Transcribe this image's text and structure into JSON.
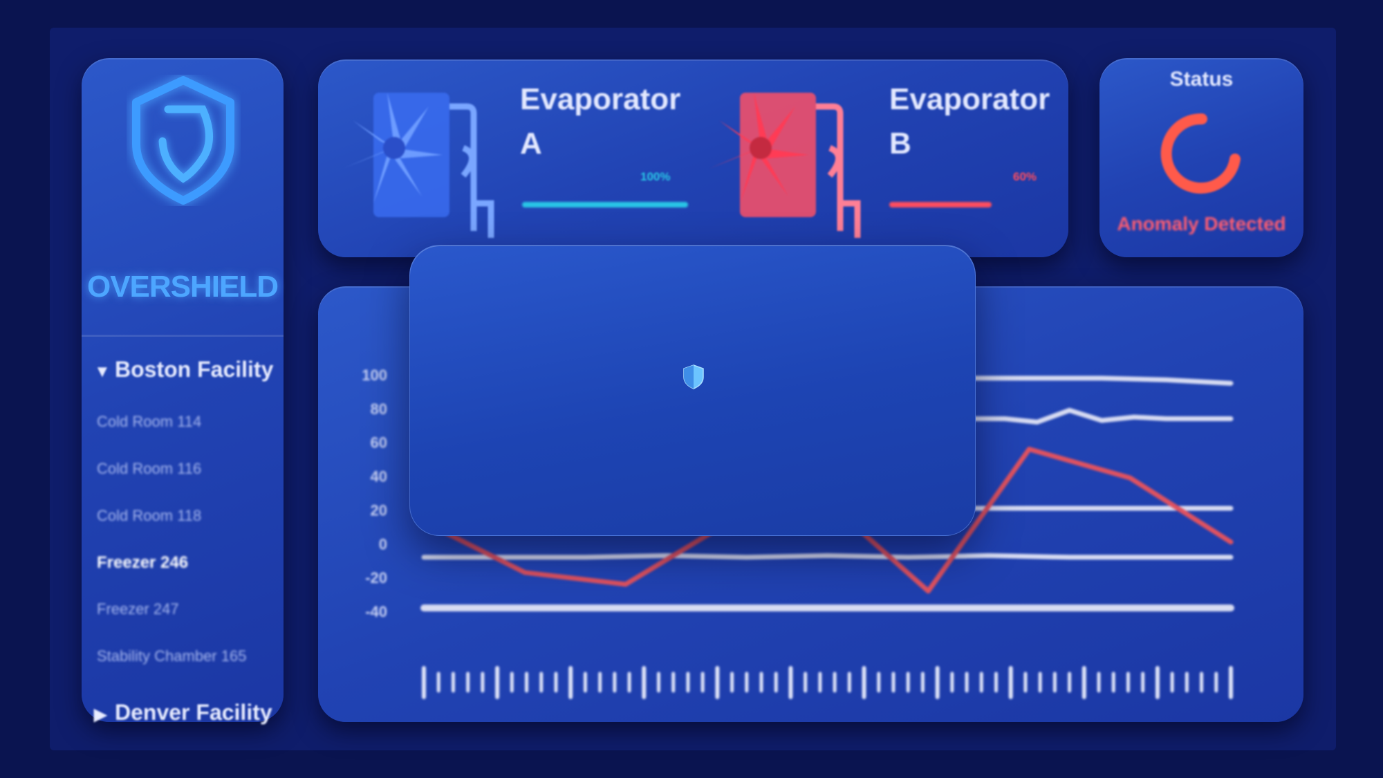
{
  "brand": {
    "name": "OVERSHIELD",
    "color": "#4da6ff",
    "logo_icon": "shield-logo-icon"
  },
  "sidebar": {
    "facilities": [
      {
        "label": "Boston Facility",
        "expanded": true,
        "icon": "triangle-down-icon",
        "rooms": [
          {
            "label": "Cold Room 114",
            "active": false
          },
          {
            "label": "Cold Room 116",
            "active": false
          },
          {
            "label": "Cold Room 118",
            "active": false
          },
          {
            "label": "Freezer 246",
            "active": true
          },
          {
            "label": "Freezer 247",
            "active": false
          },
          {
            "label": "Stability Chamber 165",
            "active": false
          }
        ]
      },
      {
        "label": "Denver Facility",
        "expanded": false,
        "icon": "triangle-right-icon"
      }
    ]
  },
  "evaporators": [
    {
      "title_line1": "Evaporator",
      "title_line2": "A",
      "percent_label": "100%",
      "level": 1.0,
      "color": "#29c6e6",
      "icon": "fan-evaporator-icon"
    },
    {
      "title_line1": "Evaporator",
      "title_line2": "B",
      "percent_label": "60%",
      "level": 0.6,
      "color": "#ff4d5e",
      "icon": "fan-evaporator-icon"
    }
  ],
  "status": {
    "label": "Status",
    "message": "Anomaly Detected",
    "color": "#ff4d5e",
    "icon": "spinner-arc-icon"
  },
  "chart_data": {
    "type": "line",
    "yticks": [
      "100",
      "80",
      "60",
      "40",
      "20",
      "0",
      "-20",
      "-40"
    ],
    "series": [
      {
        "color": "#d8dcf2",
        "visible_x": [
          0.68,
          1.0
        ],
        "values": [
          98,
          98,
          98,
          97,
          95
        ]
      },
      {
        "color": "#d8dcf2",
        "visible_x": [
          0.68,
          1.0
        ],
        "values": [
          74,
          74,
          72,
          79,
          73,
          75,
          74,
          74,
          74
        ]
      },
      {
        "color": "#d8dcf2",
        "values": [
          20,
          20,
          20,
          20,
          20,
          20,
          20,
          20,
          21,
          21,
          21,
          21,
          21
        ]
      },
      {
        "color": "#d8dcf2",
        "values": [
          -8,
          -8,
          -8,
          -7,
          -8,
          -7,
          -8,
          -7,
          -8,
          -8,
          -8
        ]
      },
      {
        "color": "#d8dcf2",
        "values": [
          -38,
          -38,
          -38
        ]
      },
      {
        "color": "#e0525f",
        "values": [
          13,
          -17,
          -24,
          12,
          25,
          -28,
          56,
          39,
          1
        ]
      }
    ]
  },
  "modal": {
    "icon": "shield-icon"
  }
}
